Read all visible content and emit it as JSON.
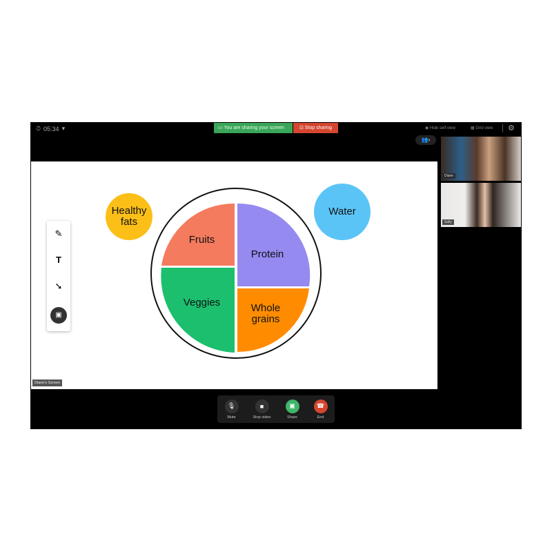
{
  "header": {
    "timer": "05:34",
    "sharing_banner": "You are sharing your screen",
    "stop_sharing": "Stop sharing",
    "hide_self_view": "Hide self view",
    "grid_view": "Grid view"
  },
  "participants": [
    {
      "name": "Diane"
    },
    {
      "name": "Sally"
    }
  ],
  "screen": {
    "label": "Diane's Screen",
    "items": {
      "healthy_fats": "Healthy fats",
      "water": "Water",
      "fruits": "Fruits",
      "protein": "Protein",
      "veggies": "Veggies",
      "whole_grains": "Whole grains"
    },
    "colors": {
      "fruits": "#F47B5E",
      "protein": "#958AF0",
      "veggies": "#1CBF6E",
      "whole_grains": "#FF8C00",
      "healthy_fats": "#FBBF18",
      "water": "#5BC4F7"
    },
    "tools": [
      "pencil-icon",
      "text-icon",
      "pointer-icon",
      "image-icon"
    ]
  },
  "controls": {
    "mute": "Mute",
    "stop_video": "Stop video",
    "share": "Share",
    "end": "End"
  }
}
